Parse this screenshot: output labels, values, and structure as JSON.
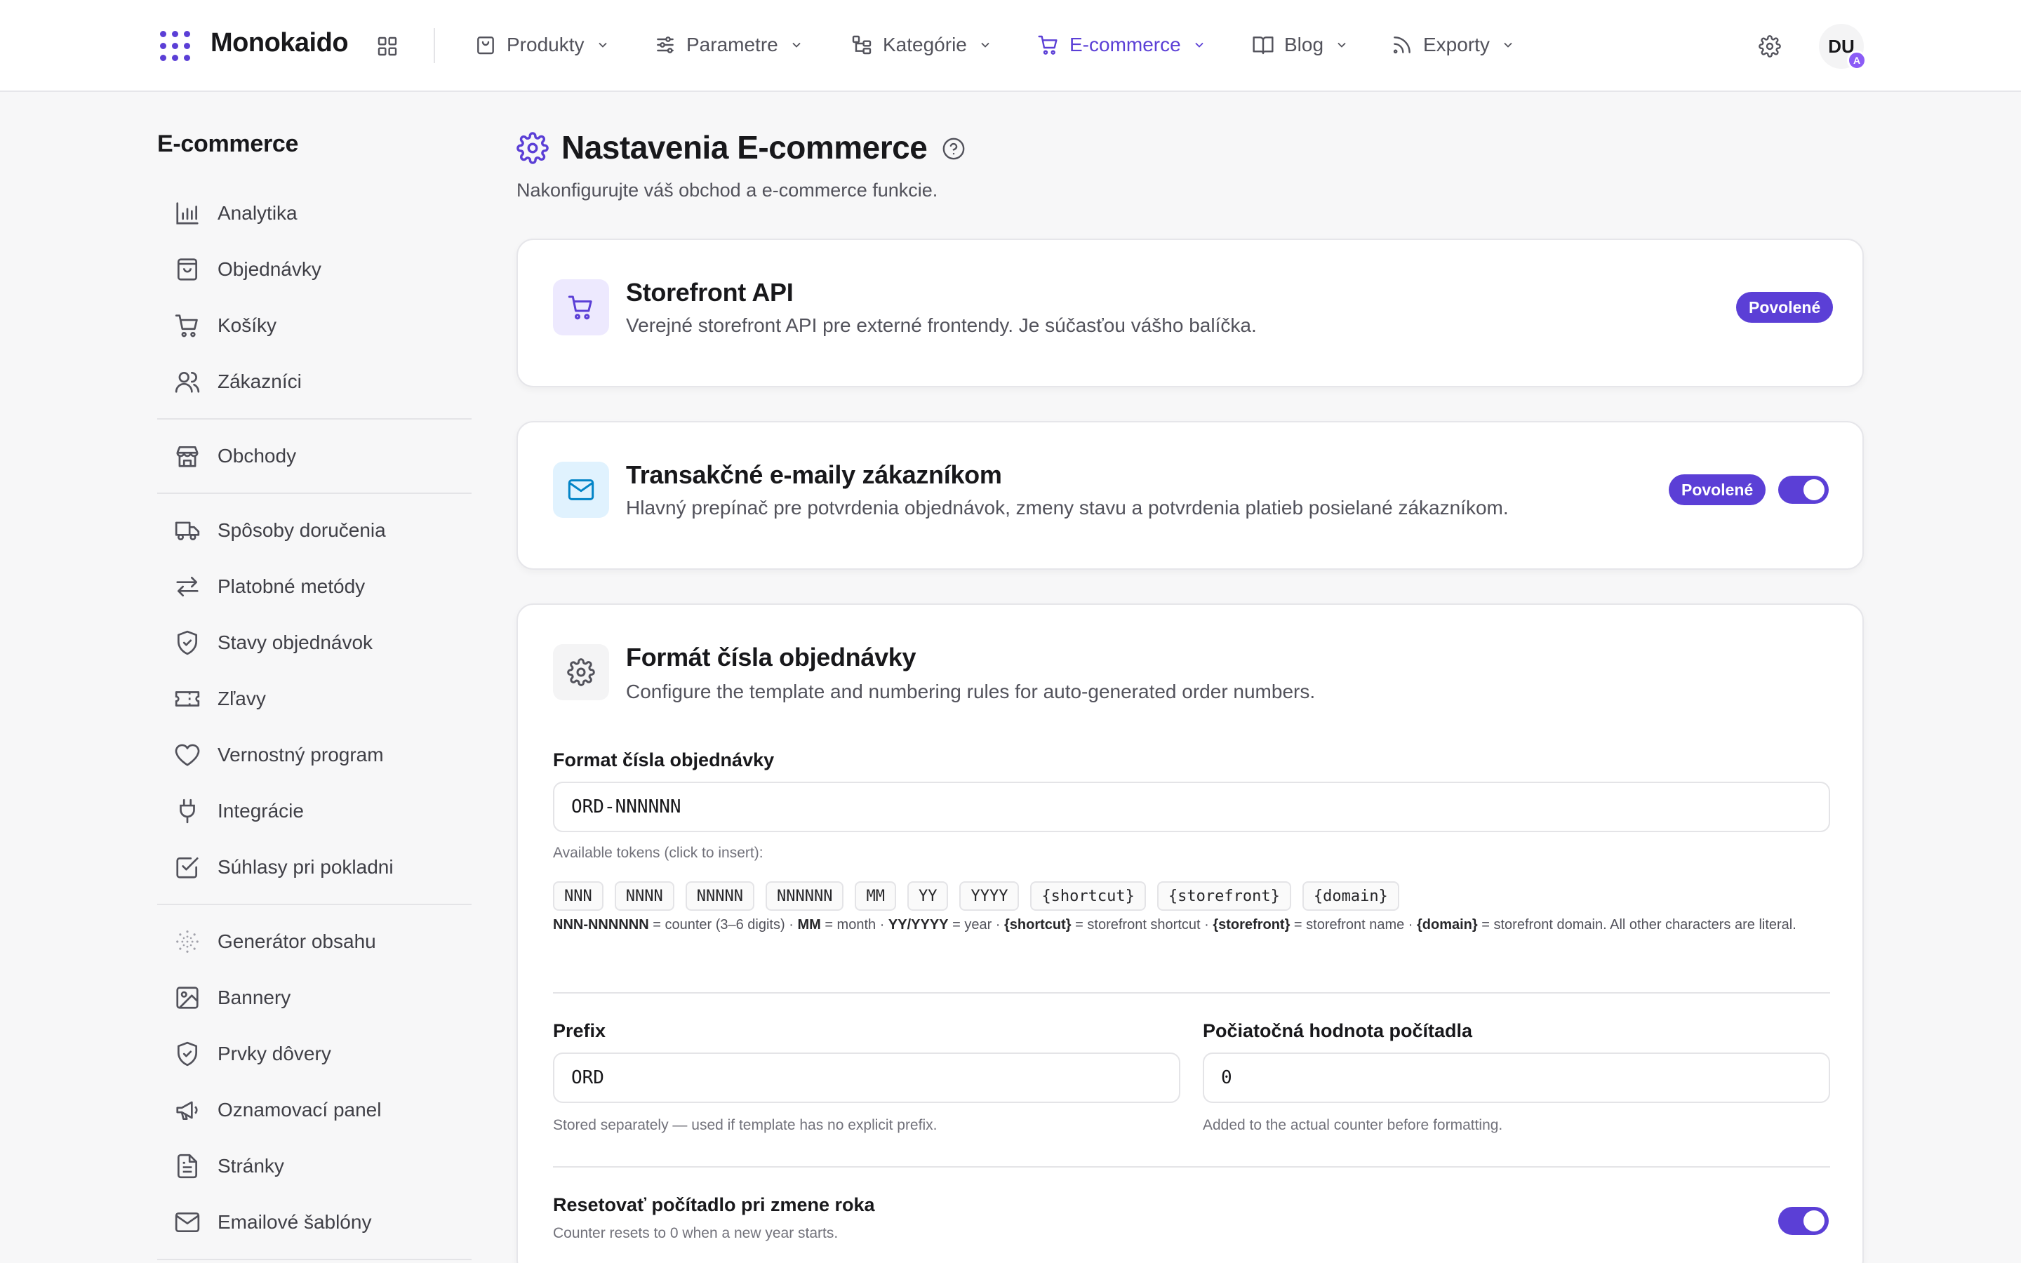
{
  "app": {
    "name": "Monokaido"
  },
  "nav": [
    {
      "label": "Produkty",
      "icon": "bag-icon"
    },
    {
      "label": "Parametre",
      "icon": "sliders-icon"
    },
    {
      "label": "Kategórie",
      "icon": "tree-icon"
    },
    {
      "label": "E-commerce",
      "icon": "cart-icon",
      "active": true
    },
    {
      "label": "Blog",
      "icon": "book-icon"
    },
    {
      "label": "Exporty",
      "icon": "rss-icon"
    }
  ],
  "user": {
    "initials": "DU",
    "badge": "A"
  },
  "sidebar": {
    "title": "E-commerce",
    "items": [
      {
        "label": "Analytika",
        "icon": "chart-icon"
      },
      {
        "label": "Objednávky",
        "icon": "bag-icon"
      },
      {
        "label": "Košíky",
        "icon": "cart-icon"
      },
      {
        "label": "Zákazníci",
        "icon": "users-icon"
      },
      {
        "label": "Obchody",
        "icon": "store-icon"
      },
      {
        "label": "Spôsoby doručenia",
        "icon": "truck-icon"
      },
      {
        "label": "Platobné metódy",
        "icon": "arrows-icon"
      },
      {
        "label": "Stavy objednávok",
        "icon": "shield-check-icon"
      },
      {
        "label": "Zľavy",
        "icon": "ticket-icon"
      },
      {
        "label": "Vernostný program",
        "icon": "heart-icon"
      },
      {
        "label": "Integrácie",
        "icon": "plug-icon"
      },
      {
        "label": "Súhlasy pri pokladni",
        "icon": "checkbox-icon"
      },
      {
        "label": "Generátor obsahu",
        "icon": "sparkle-icon"
      },
      {
        "label": "Bannery",
        "icon": "image-icon"
      },
      {
        "label": "Prvky dôvery",
        "icon": "shield-check-icon"
      },
      {
        "label": "Oznamovací panel",
        "icon": "megaphone-icon"
      },
      {
        "label": "Stránky",
        "icon": "file-icon"
      },
      {
        "label": "Emailové šablóny",
        "icon": "mail-icon"
      }
    ]
  },
  "page": {
    "title": "Nastavenia E-commerce",
    "subtitle": "Nakonfigurujte váš obchod a e-commerce funkcie."
  },
  "cards": {
    "storefront": {
      "title": "Storefront API",
      "desc": "Verejné storefront API pre externé frontendy. Je súčasťou vášho balíčka.",
      "badge": "Povolené"
    },
    "emails": {
      "title": "Transakčné e-maily zákazníkom",
      "desc": "Hlavný prepínač pre potvrdenia objednávok, zmeny stavu a potvrdenia platieb posielané zákazníkom.",
      "badge": "Povolené",
      "enabled": true
    },
    "order_format": {
      "title": "Formát čísla objednávky",
      "desc": "Configure the template and numbering rules for auto-generated order numbers.",
      "format_label": "Format čísla objednávky",
      "format_value": "ORD-NNNNNN",
      "tokens_hint": "Available tokens (click to insert):",
      "tokens": [
        "NNN",
        "NNNN",
        "NNNNN",
        "NNNNNN",
        "MM",
        "YY",
        "YYYY",
        "{shortcut}",
        "{storefront}",
        "{domain}"
      ],
      "legend": {
        "counter_key": "NNN-NNNNNN",
        "counter_text": " = counter (3–6 digits) · ",
        "month_key": "MM",
        "month_text": " = month · ",
        "year_key": "YY/YYYY",
        "year_text": " = year · ",
        "shortcut_key": "{shortcut}",
        "shortcut_text": " = storefront shortcut · ",
        "storefront_key": "{storefront}",
        "storefront_text": " = storefront name · ",
        "domain_key": "{domain}",
        "domain_text": " = storefront domain. All other characters are literal."
      },
      "prefix_label": "Prefix",
      "prefix_value": "ORD",
      "prefix_hint": "Stored separately — used if template has no explicit prefix.",
      "counter_label": "Počiatočná hodnota počítadla",
      "counter_value": "0",
      "counter_hint": "Added to the actual counter before formatting.",
      "reset_label": "Resetovať počítadlo pri zmene roka",
      "reset_hint": "Counter resets to 0 when a new year starts.",
      "reset_enabled": true
    }
  },
  "colors": {
    "accent": "#5b3fd6",
    "text": "#18181b",
    "muted": "#52525b",
    "border": "#e4e4e7"
  }
}
